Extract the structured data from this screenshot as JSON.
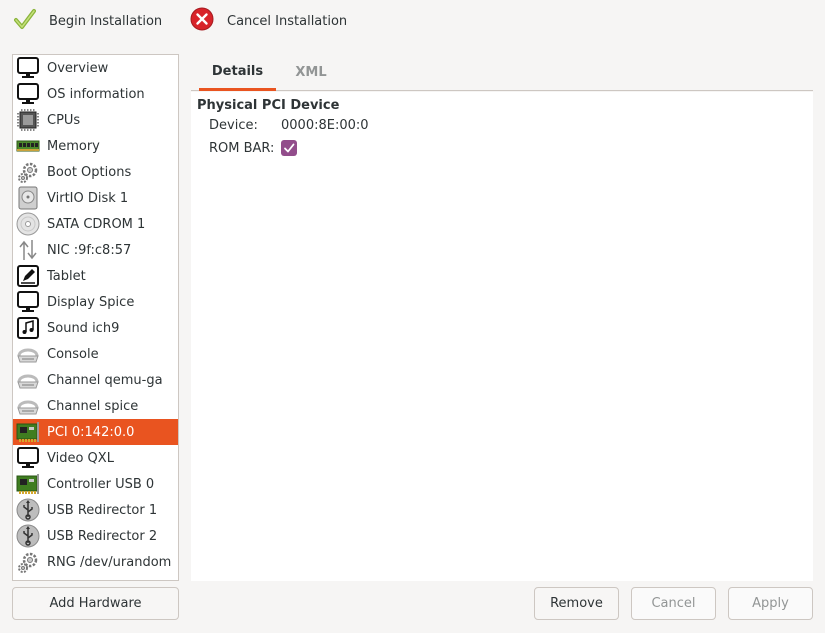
{
  "toolbar": {
    "begin_label": "Begin Installation",
    "cancel_label": "Cancel Installation"
  },
  "sidebar": {
    "items": [
      {
        "label": "Overview",
        "icon": "monitor-icon"
      },
      {
        "label": "OS information",
        "icon": "monitor-icon"
      },
      {
        "label": "CPUs",
        "icon": "cpu-icon"
      },
      {
        "label": "Memory",
        "icon": "memory-icon"
      },
      {
        "label": "Boot Options",
        "icon": "gears-icon"
      },
      {
        "label": "VirtIO Disk 1",
        "icon": "disk-icon"
      },
      {
        "label": "SATA CDROM 1",
        "icon": "cdrom-icon"
      },
      {
        "label": "NIC :9f:c8:57",
        "icon": "network-icon"
      },
      {
        "label": "Tablet",
        "icon": "tablet-icon"
      },
      {
        "label": "Display Spice",
        "icon": "monitor-icon"
      },
      {
        "label": "Sound ich9",
        "icon": "sound-icon"
      },
      {
        "label": "Console",
        "icon": "serial-icon"
      },
      {
        "label": "Channel qemu-ga",
        "icon": "serial-icon"
      },
      {
        "label": "Channel spice",
        "icon": "serial-icon"
      },
      {
        "label": "PCI 0:142:0.0",
        "icon": "pci-card-icon",
        "selected": true
      },
      {
        "label": "Video QXL",
        "icon": "monitor-icon"
      },
      {
        "label": "Controller USB 0",
        "icon": "pci-card-icon"
      },
      {
        "label": "USB Redirector 1",
        "icon": "usb-icon"
      },
      {
        "label": "USB Redirector 2",
        "icon": "usb-icon"
      },
      {
        "label": "RNG /dev/urandom",
        "icon": "gears-icon"
      }
    ],
    "add_hardware_label": "Add Hardware"
  },
  "tabs": [
    {
      "label": "Details",
      "active": true
    },
    {
      "label": "XML",
      "active": false
    }
  ],
  "details": {
    "section_title": "Physical PCI Device",
    "device_label": "Device:",
    "device_value": "0000:8E:00:0",
    "rom_bar_label": "ROM BAR:",
    "rom_bar_checked": true
  },
  "buttons": {
    "remove": "Remove",
    "cancel": "Cancel",
    "apply": "Apply"
  },
  "colors": {
    "accent": "#e95420",
    "checkbox": "#924d8b"
  }
}
